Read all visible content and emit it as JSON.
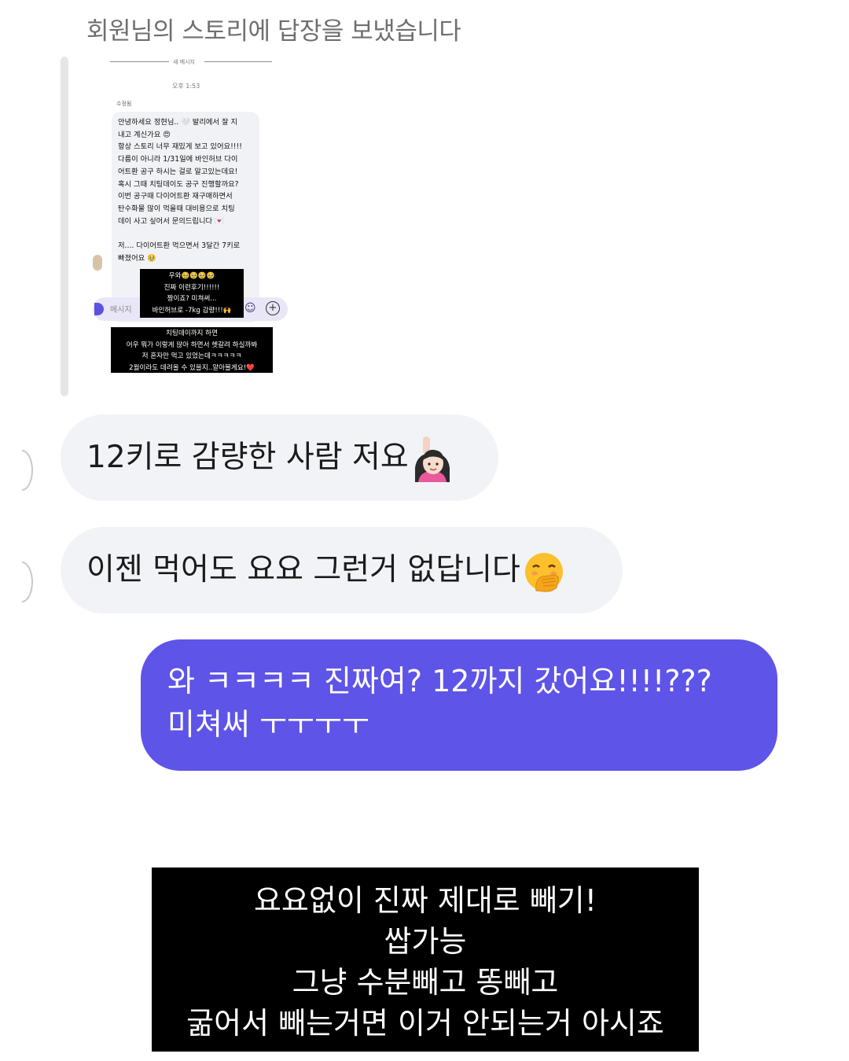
{
  "header": {
    "text": "회원님의 스토리에 답장을 보냈습니다"
  },
  "embedded": {
    "divider_label": "새 메시지",
    "time": "오후 1:53",
    "sender": "수정됨",
    "message": "안녕하세요 정현님.. 🤍 발리에서 잘 지\n내고 계신가요 😍\n항상 스토리 너무 재밌게 보고 있어요!!!!\n다름이 아니라 1/31일에 바인허브 다이\n어트환 공구 하시는 걸로 알고있는데요!\n혹시 그때 치팅데이도 공구 진행할까요?\n이번 공구때 다이어트환 재구매하면서\n탄수화물 많이 먹을때 대비용으로 치팅\n데이 사고 싶어서 문의드립니다 💌\n\n저.... 다이어트환 먹으면서 3달간 7키로\n빠졌어요 🥹",
    "input_placeholder": "메시지",
    "caption1": "우와🥹🥹🥹🥹\n진짜 이런후기!!!!!!\n짱이죠? 미쳐써...\n바인허브로 -7kg 감량!!!🙌",
    "caption2": "치팅데이까지 하면\n어우 뭐가 이렇게 많아 하면서 헷갈려 하실까봐\n저 혼자만 먹고 있었는데ㅋㅋㅋㅋㅋ\n2월이라도 데려올 수 있을지..알아볼게요!❤️"
  },
  "messages": [
    {
      "text": "12키로 감량한 사람 저요",
      "emoji": "raising-hand-emoji"
    },
    {
      "text": "이젠 먹어도 요요 그런거 없답니다",
      "emoji": "hand-over-mouth-emoji"
    }
  ],
  "sent": {
    "text": "와 ㅋㅋㅋㅋ 진짜여? 12까지 갔어요!!!!???\n미쳐써 ㅜㅜㅜㅜ"
  },
  "caption": {
    "text": "요요없이 진짜 제대로 빼기!\n쌉가능\n그냥 수분빼고 똥빼고\n굶어서 빼는거면 이거 안되는거 아시죠"
  },
  "colors": {
    "sent_bubble": "#5e54e8",
    "received_bubble": "#f2f3f7",
    "caption_bg": "#000000"
  }
}
